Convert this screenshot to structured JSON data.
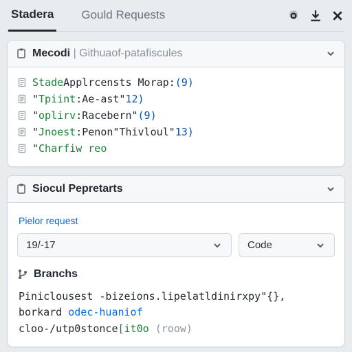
{
  "tabs": {
    "active": "Stadera",
    "inactive": "Gould Requests"
  },
  "panel1": {
    "title_strong": "Mecodi",
    "title_muted": "Githuaof-patafiscules",
    "rows": [
      {
        "key": "Stade",
        "sep": " ",
        "str": "Applrcensts Morap:",
        "num": "(9)"
      },
      {
        "q": "\"",
        "key": "Tpiint",
        "sep": ":",
        "str": "Ae-ast\"",
        "num": "12)"
      },
      {
        "q": "\"",
        "key": "oplirv",
        "sep": ":",
        "str": "Racebern\"",
        "num": "(9)"
      },
      {
        "q": "\"",
        "key": "Jnoest",
        "sep": ":",
        "str": "Penon\"Thivloul\"",
        "num": "13)"
      },
      {
        "q": "\"",
        "key": "Charfiw reo",
        "sep": "",
        "str": "",
        "num": "",
        "muted": true
      }
    ]
  },
  "panel2": {
    "title": "Siocul Pepretarts",
    "link": "Pielor request",
    "select1": "19/-17",
    "select2": "Code",
    "branches_label": "Branchs",
    "code": {
      "l1a": "Piniclousest ",
      "l1b": "-bizeions.lipelatldinirxpy\"{},",
      "l2a": "borkard ",
      "l2b": "odec-huaniof",
      "l3a": "cloo-/utp0stonce",
      "l3b": "[it0o ",
      "l3c": "(roow)"
    }
  }
}
